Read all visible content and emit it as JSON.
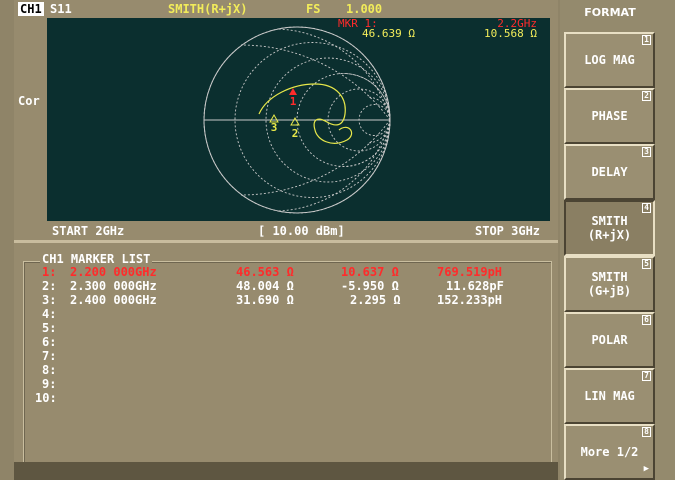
{
  "topbar": {
    "channel": "CH1",
    "param": "S11",
    "format": "SMITH(R+jX)",
    "scale_label": "FS",
    "scale_value": "1.000"
  },
  "cor": "Cor",
  "marker_readout": {
    "line1_label": "MKR  1:",
    "line1_freq": "2.2GHz",
    "line2_r": "46.639 Ω",
    "line2_x": "10.568 Ω"
  },
  "sweep": {
    "start": "START 2GHz",
    "power": "[ 10.00 dBm]",
    "stop": "STOP 3GHz"
  },
  "plot_markers": [
    "1",
    "2",
    "3"
  ],
  "marker_list": {
    "title": "CH1 MARKER LIST",
    "rows": [
      {
        "index": "1:",
        "freq": "2.200 000GHz",
        "r": "46.563 Ω",
        "x": "10.637 Ω",
        "lc": "769.519pH",
        "active": true
      },
      {
        "index": "2:",
        "freq": "2.300 000GHz",
        "r": "48.004 Ω",
        "x": "-5.950 Ω",
        "lc": "11.628pF",
        "active": false
      },
      {
        "index": "3:",
        "freq": "2.400 000GHz",
        "r": "31.690 Ω",
        "x": "2.295 Ω",
        "lc": "152.233pH",
        "active": false
      },
      {
        "index": "4:",
        "freq": "",
        "r": "",
        "x": "",
        "lc": "",
        "active": false
      },
      {
        "index": "5:",
        "freq": "",
        "r": "",
        "x": "",
        "lc": "",
        "active": false
      },
      {
        "index": "6:",
        "freq": "",
        "r": "",
        "x": "",
        "lc": "",
        "active": false
      },
      {
        "index": "7:",
        "freq": "",
        "r": "",
        "x": "",
        "lc": "",
        "active": false
      },
      {
        "index": "8:",
        "freq": "",
        "r": "",
        "x": "",
        "lc": "",
        "active": false
      },
      {
        "index": "9:",
        "freq": "",
        "r": "",
        "x": "",
        "lc": "",
        "active": false
      },
      {
        "index": "10:",
        "freq": "",
        "r": "",
        "x": "",
        "lc": "",
        "active": false
      }
    ]
  },
  "softkeys": {
    "title": "FORMAT",
    "keys": [
      {
        "num": "1",
        "line1": "LOG MAG",
        "line2": "",
        "selected": false
      },
      {
        "num": "2",
        "line1": "PHASE",
        "line2": "",
        "selected": false
      },
      {
        "num": "3",
        "line1": "DELAY",
        "line2": "",
        "selected": false
      },
      {
        "num": "4",
        "line1": "SMITH",
        "line2": "(R+jX)",
        "selected": true
      },
      {
        "num": "5",
        "line1": "SMITH",
        "line2": "(G+jB)",
        "selected": false
      },
      {
        "num": "6",
        "line1": "POLAR",
        "line2": "",
        "selected": false
      },
      {
        "num": "7",
        "line1": "LIN MAG",
        "line2": "",
        "selected": false
      },
      {
        "num": "8",
        "line1": "More 1/2",
        "line2": "",
        "selected": false,
        "arrow": "▶"
      }
    ]
  },
  "colors": {
    "background": "#978b6e",
    "plot_background": "#0b2f2f",
    "trace": "#e8e84a",
    "marker_active": "#ff2b2b",
    "grid": "#c9c9c9"
  }
}
